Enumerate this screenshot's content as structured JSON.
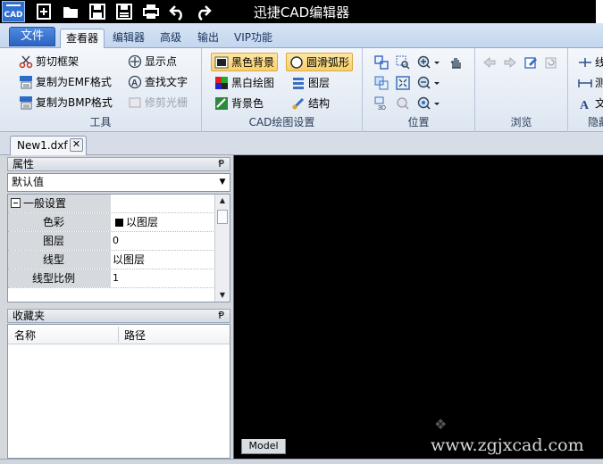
{
  "titlebar": {
    "app_icon_label": "CAD",
    "title": "迅捷CAD编辑器",
    "quick_access": [
      "new-icon",
      "open-icon",
      "save-icon",
      "save-as-icon",
      "print-icon",
      "undo-icon",
      "redo-icon"
    ]
  },
  "tabs": {
    "file": "文件",
    "viewer": "查看器",
    "editor": "编辑器",
    "advanced": "高级",
    "output": "输出",
    "vip": "VIP功能"
  },
  "groups": {
    "tools": {
      "label": "工具",
      "clip_frame": "剪切框架",
      "copy_emf": "复制为EMF格式",
      "copy_bmp": "复制为BMP格式",
      "show_points": "显示点",
      "find_text": "查找文字",
      "trim_raster": "修剪光栅"
    },
    "draw_settings": {
      "label": "CAD绘图设置",
      "black_bg": "黑色背景",
      "bw_draw": "黑白绘图",
      "bg_color": "背景色",
      "smooth_arc": "圆滑弧形",
      "layers": "图层",
      "structure": "结构"
    },
    "position": {
      "label": "位置"
    },
    "browse": {
      "label": "浏览"
    },
    "hidden": {
      "label": "隐藏",
      "line": "线",
      "measure": "测",
      "text": "文"
    }
  },
  "document": {
    "tab_name": "New1.dxf",
    "close_glyph": "✕"
  },
  "properties": {
    "header": "属性",
    "pin": "Ᵽ",
    "dropdown_value": "默认值",
    "category": "一般设置",
    "rows": [
      {
        "name": "色彩",
        "value": "以图层",
        "swatch": "#000000"
      },
      {
        "name": "图层",
        "value": "0"
      },
      {
        "name": "线型",
        "value": "以图层"
      },
      {
        "name": "线型比例",
        "value": "1"
      }
    ]
  },
  "favorites": {
    "header": "收藏夹",
    "col_name": "名称",
    "col_path": "路径"
  },
  "canvas": {
    "background": "#000000",
    "model_tab": "Model"
  },
  "watermark": "www.zgjxcad.com"
}
